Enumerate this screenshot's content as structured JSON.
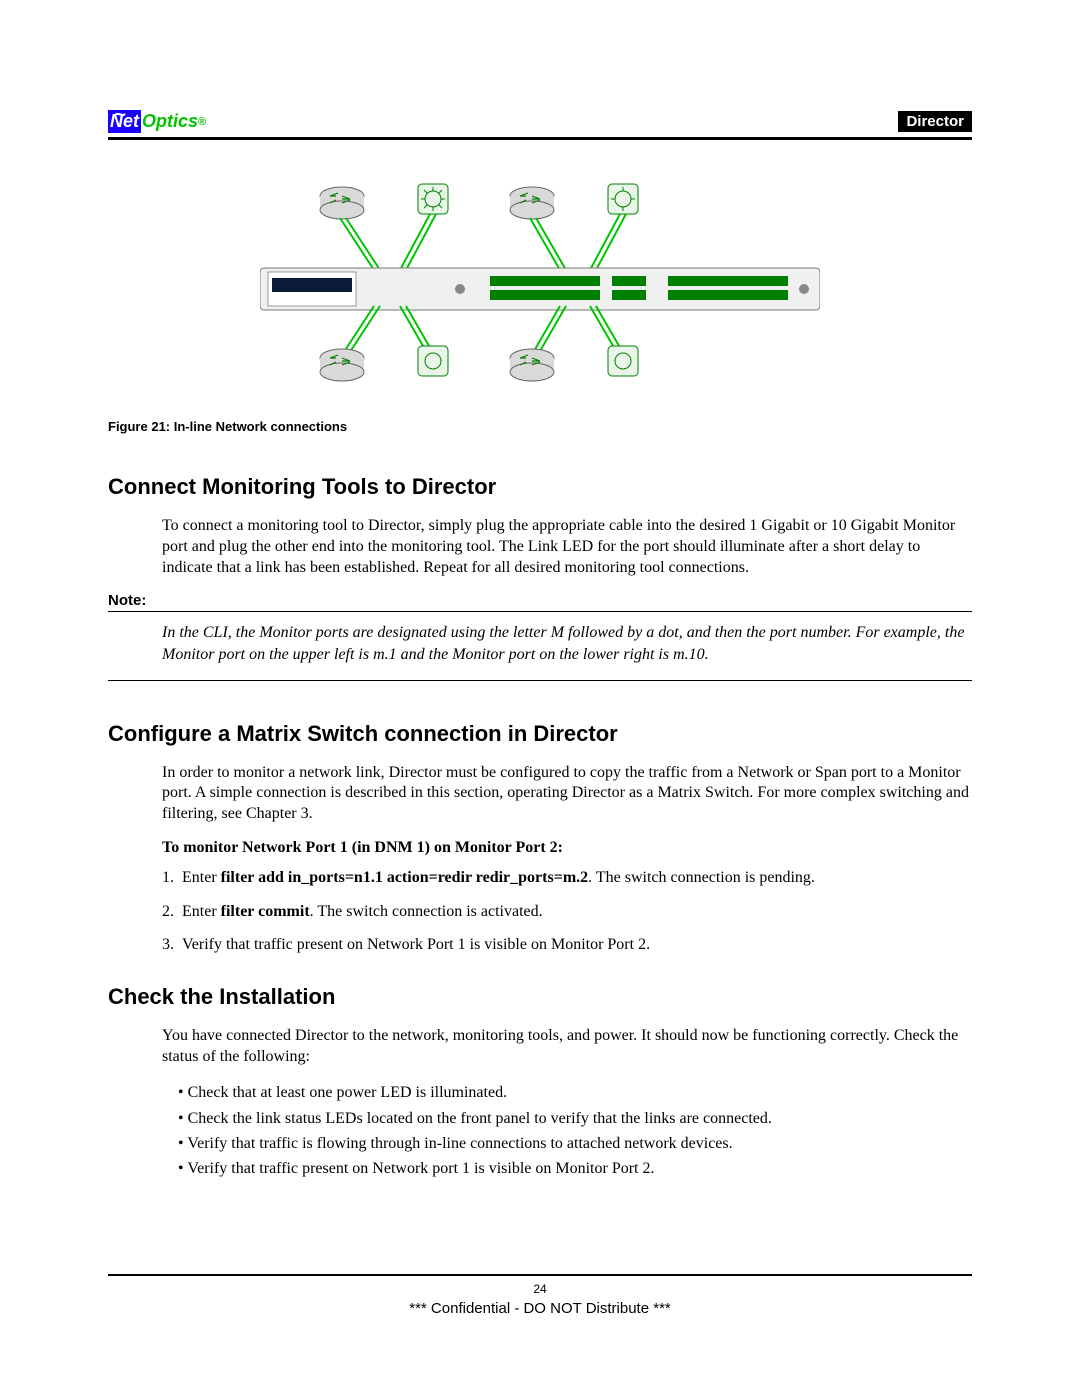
{
  "header": {
    "logo_net": "Net",
    "logo_optics": "Optics",
    "right_label": "Director"
  },
  "figure": {
    "caption": "Figure 21: In-line Network connections"
  },
  "section1": {
    "title": "Connect Monitoring Tools to Director",
    "body": "To connect a monitoring tool to Director, simply plug the appropriate cable into the desired 1 Gigabit or 10 Gigabit Monitor port and plug the other end into the monitoring tool. The Link LED for the port should illuminate after a short delay to indicate that a link has been established. Repeat for all desired monitoring tool connections."
  },
  "note": {
    "label": "Note:",
    "text": "In the CLI, the Monitor ports are designated using the letter M followed by a dot, and then the port number. For example, the Monitor port on the upper left is m.1 and the Monitor port on the lower right is m.10."
  },
  "section2": {
    "title": "Configure a Matrix Switch connection in Director",
    "body": "In order to monitor a network link, Director must be configured to copy the traffic from a Network or Span port to  a Monitor port. A simple connection is described in this section, operating Director as a Matrix Switch. For more complex switching and filtering, see Chapter 3.",
    "subhead": "To monitor Network Port 1 (in DNM 1) on Monitor Port 2:",
    "step1_pre": "Enter ",
    "step1_bold": "filter add in_ports=n1.1 action=redir redir_ports=m.2",
    "step1_post": ". The switch connection is pending.",
    "step2_pre": "Enter ",
    "step2_bold": "filter commit",
    "step2_post": ". The switch connection is activated.",
    "step3": "Verify that traffic present on Network Port 1 is visible on Monitor Port 2."
  },
  "section3": {
    "title": "Check the Installation",
    "body": "You have connected Director to the network, monitoring tools, and power. It should now be functioning correctly. Check the status of the following:",
    "bullets": [
      "Check that at least one power LED is illuminated.",
      "Check the link status LEDs located on the front panel to verify that the links are connected.",
      "Verify that traffic is flowing through in-line connections to attached network devices.",
      "Verify that traffic present on Network port  1 is visible on Monitor Port 2."
    ]
  },
  "footer": {
    "page": "24",
    "confidential": "*** Confidential - DO NOT Distribute ***"
  }
}
